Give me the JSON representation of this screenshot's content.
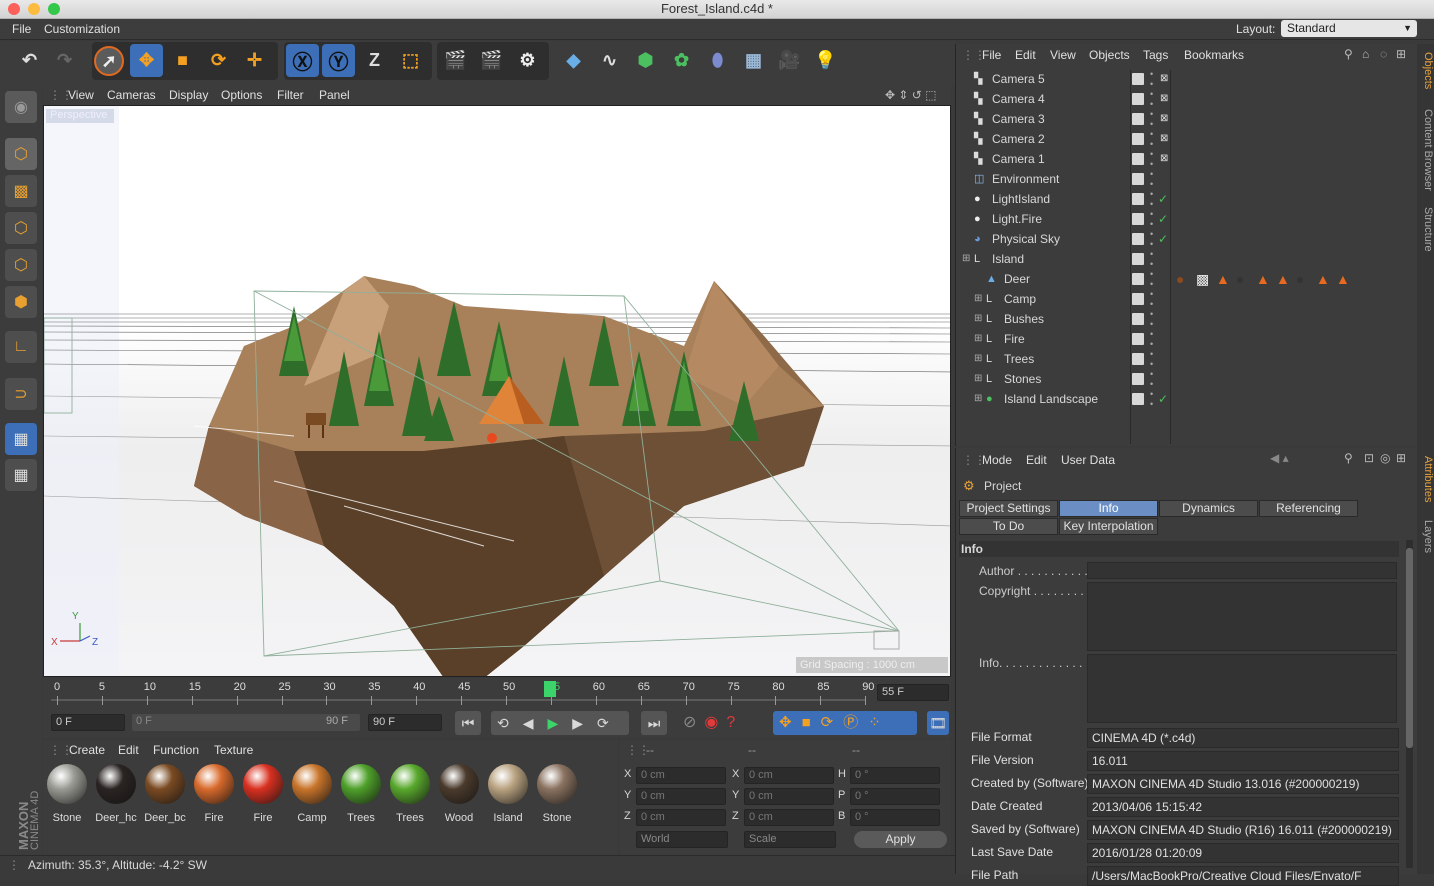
{
  "window": {
    "title": "Forest_Island.c4d *"
  },
  "menubar": {
    "items": [
      "File",
      "Customization"
    ],
    "layout_label": "Layout:",
    "layout_value": "Standard"
  },
  "viewport": {
    "menu": [
      "View",
      "Cameras",
      "Display",
      "Options",
      "Filter",
      "Panel"
    ],
    "label": "Perspective",
    "grid_spacing": "Grid Spacing : 1000 cm",
    "axis": {
      "x": "X",
      "y": "Y",
      "z": "Z"
    }
  },
  "timeline": {
    "ticks": [
      "0",
      "5",
      "10",
      "15",
      "20",
      "25",
      "30",
      "35",
      "40",
      "45",
      "50",
      "55",
      "60",
      "65",
      "70",
      "75",
      "80",
      "85",
      "90"
    ],
    "current": "55",
    "frame_field": "55 F"
  },
  "anim": {
    "start": "0 F",
    "range_start": "0 F",
    "range_end": "90 F",
    "end": "90 F"
  },
  "materials": {
    "menu": [
      "Create",
      "Edit",
      "Function",
      "Texture"
    ],
    "items": [
      {
        "name": "Stone",
        "color": "#9a9a94"
      },
      {
        "name": "Deer_hc",
        "color": "#2a2422"
      },
      {
        "name": "Deer_bc",
        "color": "#7a4a22"
      },
      {
        "name": "Fire",
        "color": "#d86a2c"
      },
      {
        "name": "Fire",
        "color": "#d83020"
      },
      {
        "name": "Camp",
        "color": "#c8742a"
      },
      {
        "name": "Trees",
        "color": "#4ea02a"
      },
      {
        "name": "Trees",
        "color": "#58a82c"
      },
      {
        "name": "Wood",
        "color": "#4a3a2c"
      },
      {
        "name": "Island",
        "color": "#b8a280"
      },
      {
        "name": "Stone",
        "color": "#8a7260"
      }
    ]
  },
  "coords": {
    "headers": [
      "--",
      "--",
      "--"
    ],
    "pos": [
      {
        "l": "X",
        "v": "0 cm"
      },
      {
        "l": "Y",
        "v": "0 cm"
      },
      {
        "l": "Z",
        "v": "0 cm"
      }
    ],
    "size": [
      {
        "l": "X",
        "v": "0 cm"
      },
      {
        "l": "Y",
        "v": "0 cm"
      },
      {
        "l": "Z",
        "v": "0 cm"
      }
    ],
    "rot": [
      {
        "l": "H",
        "v": "0 °"
      },
      {
        "l": "P",
        "v": "0 °"
      },
      {
        "l": "B",
        "v": "0 °"
      }
    ],
    "world": "World",
    "scale": "Scale",
    "apply": "Apply"
  },
  "status": "Azimuth: 35.3°, Altitude: -4.2°  SW",
  "objects": {
    "menu": [
      "File",
      "Edit",
      "View",
      "Objects",
      "Tags",
      "Bookmarks"
    ],
    "rows": [
      {
        "name": "Camera 5",
        "indent": 0,
        "icon": "camera",
        "check": false
      },
      {
        "name": "Camera 4",
        "indent": 0,
        "icon": "camera",
        "check": false
      },
      {
        "name": "Camera 3",
        "indent": 0,
        "icon": "camera",
        "check": false
      },
      {
        "name": "Camera 2",
        "indent": 0,
        "icon": "camera",
        "check": false
      },
      {
        "name": "Camera 1",
        "indent": 0,
        "icon": "camera",
        "check": false
      },
      {
        "name": "Environment",
        "indent": 0,
        "icon": "env",
        "check": false
      },
      {
        "name": "LightIsland",
        "indent": 0,
        "icon": "light",
        "check": true
      },
      {
        "name": "Light.Fire",
        "indent": 0,
        "icon": "light",
        "check": true
      },
      {
        "name": "Physical Sky",
        "indent": 0,
        "icon": "sky",
        "check": true
      },
      {
        "name": "Island",
        "indent": 0,
        "icon": "null",
        "check": false
      },
      {
        "name": "Deer",
        "indent": 1,
        "icon": "poly",
        "check": false
      },
      {
        "name": "Camp",
        "indent": 1,
        "icon": "null",
        "check": false
      },
      {
        "name": "Bushes",
        "indent": 1,
        "icon": "null",
        "check": false
      },
      {
        "name": "Fire",
        "indent": 1,
        "icon": "null",
        "check": false
      },
      {
        "name": "Trees",
        "indent": 1,
        "icon": "null",
        "check": false
      },
      {
        "name": "Stones",
        "indent": 1,
        "icon": "null",
        "check": false
      },
      {
        "name": "Island Landscape",
        "indent": 1,
        "icon": "landscape",
        "check": true
      }
    ]
  },
  "attributes": {
    "menu": [
      "Mode",
      "Edit",
      "User Data"
    ],
    "title": "Project",
    "tabs": [
      "Project Settings",
      "Info",
      "Dynamics",
      "Referencing",
      "To Do",
      "Key Interpolation"
    ],
    "section": "Info",
    "author_label": "Author . . . . . . . . . . .",
    "copyright_label": "Copyright . . . . . . . .",
    "info_label": "Info. . . . . . . . . . . . .",
    "fields": [
      {
        "label": "File Format",
        "value": "CINEMA 4D (*.c4d)"
      },
      {
        "label": "File Version",
        "value": "16.011"
      },
      {
        "label": "Created by (Software)",
        "value": "MAXON CINEMA 4D Studio 13.016 (#200000219)"
      },
      {
        "label": "Date Created",
        "value": "2013/04/06 15:15:42"
      },
      {
        "label": "Saved by (Software)",
        "value": "MAXON CINEMA 4D Studio (R16) 16.011 (#200000219)"
      },
      {
        "label": "Last Save Date",
        "value": "2016/01/28 01:20:09"
      },
      {
        "label": "File Path",
        "value": "/Users/MacBookPro/Creative Cloud Files/Envato/F"
      }
    ]
  },
  "sidetabs": [
    "Objects",
    "Content Browser",
    "Structure",
    "Attributes",
    "Layers"
  ],
  "brand": "MAXON CINEMA 4D"
}
